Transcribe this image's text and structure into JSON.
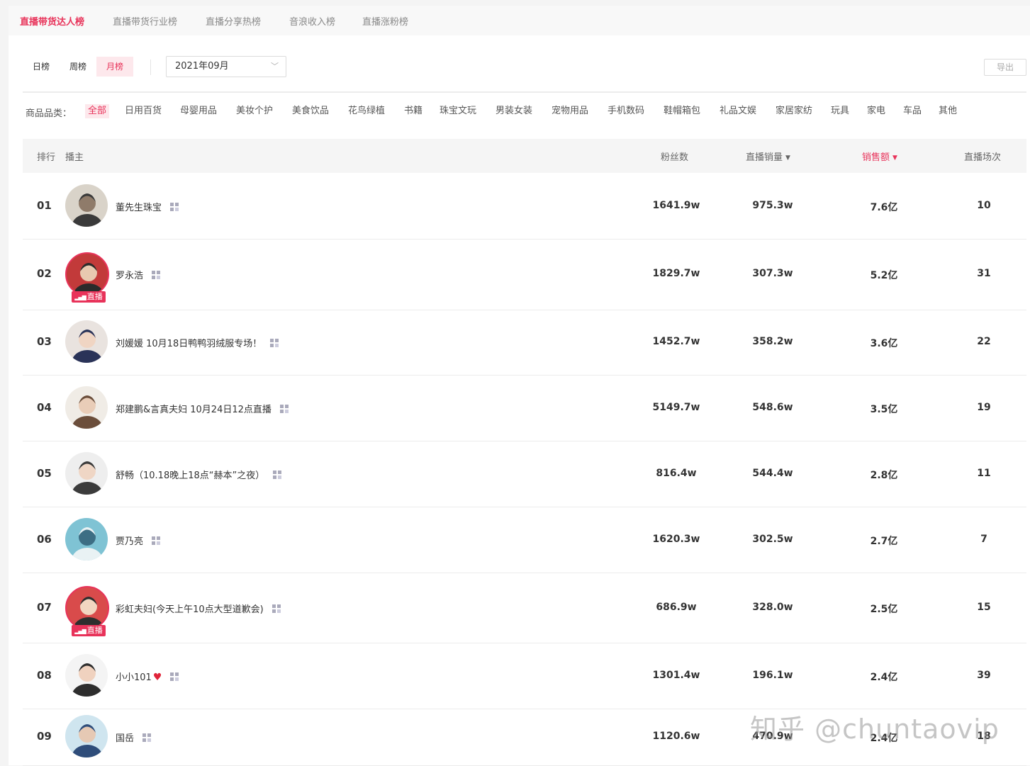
{
  "tabs": [
    "直播带货达人榜",
    "直播带货行业榜",
    "直播分享热榜",
    "音浪收入榜",
    "直播涨粉榜"
  ],
  "active_tab": "直播带货达人榜",
  "period": {
    "options": [
      "日榜",
      "周榜",
      "月榜"
    ],
    "active": "月榜"
  },
  "month_select": {
    "value": "2021年09月"
  },
  "export_label": "导出",
  "categories": {
    "label": "商品品类：",
    "active": "全部",
    "items": [
      "全部",
      "日用百货",
      "母婴用品",
      "美妆个护",
      "美食饮品",
      "花鸟绿植",
      "书籍",
      "珠宝文玩",
      "男装女装",
      "宠物用品",
      "手机数码",
      "鞋帽箱包",
      "礼品文娱",
      "家居家纺",
      "玩具",
      "家电",
      "车品",
      "其他"
    ]
  },
  "table": {
    "headers": {
      "rank": "排行",
      "anchor": "播主",
      "fans": "粉丝数",
      "sales": "直播销量",
      "revenue": "销售额",
      "sessions": "直播场次"
    },
    "sorted_column": "revenue",
    "live_label": "直播",
    "rows": [
      {
        "rank": "01",
        "name": "董先生珠宝",
        "fans": "1641.9w",
        "sales": "975.3w",
        "revenue": "7.6亿",
        "sessions": "10",
        "live": false,
        "heart": false
      },
      {
        "rank": "02",
        "name": "罗永浩",
        "fans": "1829.7w",
        "sales": "307.3w",
        "revenue": "5.2亿",
        "sessions": "31",
        "live": true,
        "heart": false
      },
      {
        "rank": "03",
        "name": "刘媛媛 10月18日鸭鸭羽绒服专场！",
        "fans": "1452.7w",
        "sales": "358.2w",
        "revenue": "3.6亿",
        "sessions": "22",
        "live": false,
        "heart": false
      },
      {
        "rank": "04",
        "name": "郑建鹏&言真夫妇 10月24日12点直播",
        "fans": "5149.7w",
        "sales": "548.6w",
        "revenue": "3.5亿",
        "sessions": "19",
        "live": false,
        "heart": false
      },
      {
        "rank": "05",
        "name": "舒畅（10.18晚上18点“赫本”之夜）",
        "fans": "816.4w",
        "sales": "544.4w",
        "revenue": "2.8亿",
        "sessions": "11",
        "live": false,
        "heart": false
      },
      {
        "rank": "06",
        "name": "贾乃亮",
        "fans": "1620.3w",
        "sales": "302.5w",
        "revenue": "2.7亿",
        "sessions": "7",
        "live": false,
        "heart": false
      },
      {
        "rank": "07",
        "name": "彩虹夫妇(今天上午10点大型道歉会)",
        "fans": "686.9w",
        "sales": "328.0w",
        "revenue": "2.5亿",
        "sessions": "15",
        "live": true,
        "heart": false
      },
      {
        "rank": "08",
        "name": "小小101",
        "fans": "1301.4w",
        "sales": "196.1w",
        "revenue": "2.4亿",
        "sessions": "39",
        "live": false,
        "heart": true
      },
      {
        "rank": "09",
        "name": "国岳",
        "fans": "1120.6w",
        "sales": "470.9w",
        "revenue": "2.4亿",
        "sessions": "18",
        "live": false,
        "heart": false
      }
    ]
  },
  "watermark": "知乎 @chuntaovip",
  "colors": {
    "accent": "#e8335a",
    "accent_bg": "#fde8ec",
    "header_bg": "#f5f5f5"
  }
}
